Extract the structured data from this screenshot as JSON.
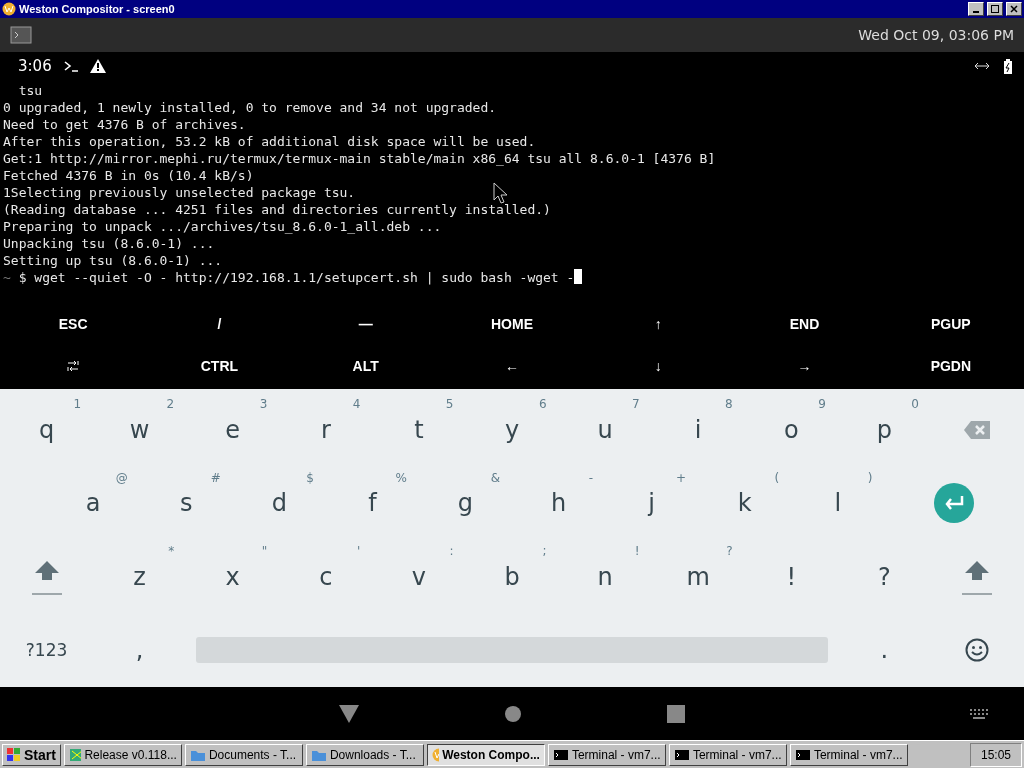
{
  "window": {
    "title": "Weston Compositor - screen0"
  },
  "panel": {
    "clock": "Wed Oct 09, 03:06 PM"
  },
  "status_bar": {
    "time": "3:06"
  },
  "terminal": {
    "lines": [
      "  tsu",
      "0 upgraded, 1 newly installed, 0 to remove and 34 not upgraded.",
      "Need to get 4376 B of archives.",
      "After this operation, 53.2 kB of additional disk space will be used.",
      "Get:1 http://mirror.mephi.ru/termux/termux-main stable/main x86_64 tsu all 8.6.0-1 [4376 B]",
      "Fetched 4376 B in 0s (10.4 kB/s)",
      "1Selecting previously unselected package tsu.",
      "(Reading database ... 4251 files and directories currently installed.)",
      "Preparing to unpack .../archives/tsu_8.6.0-1_all.deb ...",
      "Unpacking tsu (8.6.0-1) ...",
      "Setting up tsu (8.6.0-1) ..."
    ],
    "prompt": {
      "dir": "~",
      "symbol": "$",
      "command": "wget --quiet -O - http://192.168.1.1/setupcert.sh | sudo bash -wget -"
    }
  },
  "extra_keys": [
    [
      {
        "kind": "text",
        "label": "ESC"
      },
      {
        "kind": "text",
        "label": "/"
      },
      {
        "kind": "text",
        "label": "—"
      },
      {
        "kind": "text",
        "label": "HOME"
      },
      {
        "kind": "text",
        "label": "↑"
      },
      {
        "kind": "text",
        "label": "END"
      },
      {
        "kind": "text",
        "label": "PGUP"
      }
    ],
    [
      {
        "kind": "tab"
      },
      {
        "kind": "text",
        "label": "CTRL"
      },
      {
        "kind": "text",
        "label": "ALT"
      },
      {
        "kind": "text",
        "label": "←"
      },
      {
        "kind": "text",
        "label": "↓"
      },
      {
        "kind": "text",
        "label": "→"
      },
      {
        "kind": "text",
        "label": "PGDN"
      }
    ]
  ],
  "keyboard": [
    [
      {
        "kind": "char",
        "label": "q",
        "hint": "1"
      },
      {
        "kind": "char",
        "label": "w",
        "hint": "2"
      },
      {
        "kind": "char",
        "label": "e",
        "hint": "3"
      },
      {
        "kind": "char",
        "label": "r",
        "hint": "4"
      },
      {
        "kind": "char",
        "label": "t",
        "hint": "5"
      },
      {
        "kind": "char",
        "label": "y",
        "hint": "6"
      },
      {
        "kind": "char",
        "label": "u",
        "hint": "7"
      },
      {
        "kind": "char",
        "label": "i",
        "hint": "8"
      },
      {
        "kind": "char",
        "label": "o",
        "hint": "9"
      },
      {
        "kind": "char",
        "label": "p",
        "hint": "0"
      },
      {
        "kind": "backspace"
      }
    ],
    [
      {
        "kind": "gap"
      },
      {
        "kind": "char",
        "label": "a",
        "hint": "@"
      },
      {
        "kind": "char",
        "label": "s",
        "hint": "#"
      },
      {
        "kind": "char",
        "label": "d",
        "hint": "$"
      },
      {
        "kind": "char",
        "label": "f",
        "hint": "%"
      },
      {
        "kind": "char",
        "label": "g",
        "hint": "&"
      },
      {
        "kind": "char",
        "label": "h",
        "hint": "-"
      },
      {
        "kind": "char",
        "label": "j",
        "hint": "+"
      },
      {
        "kind": "char",
        "label": "k",
        "hint": "("
      },
      {
        "kind": "char",
        "label": "l",
        "hint": ")"
      },
      {
        "kind": "enter"
      }
    ],
    [
      {
        "kind": "shift"
      },
      {
        "kind": "char",
        "label": "z",
        "hint": "*"
      },
      {
        "kind": "char",
        "label": "x",
        "hint": "\""
      },
      {
        "kind": "char",
        "label": "c",
        "hint": "'"
      },
      {
        "kind": "char",
        "label": "v",
        "hint": ":"
      },
      {
        "kind": "char",
        "label": "b",
        "hint": ";"
      },
      {
        "kind": "char",
        "label": "n",
        "hint": "!"
      },
      {
        "kind": "char",
        "label": "m",
        "hint": "?"
      },
      {
        "kind": "char",
        "label": "!"
      },
      {
        "kind": "char",
        "label": "?"
      },
      {
        "kind": "shift"
      }
    ],
    [
      {
        "kind": "mode",
        "label": "?123"
      },
      {
        "kind": "char",
        "label": ","
      },
      {
        "kind": "space"
      },
      {
        "kind": "char",
        "label": "."
      },
      {
        "kind": "emoji"
      }
    ]
  ],
  "taskbar": {
    "start": "Start",
    "clock": "15:05",
    "tasks": [
      {
        "kind": "app",
        "label": "Release v0.118...",
        "selected": false
      },
      {
        "kind": "folder",
        "label": "Documents - T...",
        "selected": false
      },
      {
        "kind": "folder",
        "label": "Downloads - T...",
        "selected": false
      },
      {
        "kind": "weston",
        "label": "Weston Compo...",
        "selected": true
      },
      {
        "kind": "terminal",
        "label": "Terminal - vm7...",
        "selected": false
      },
      {
        "kind": "terminal",
        "label": "Terminal - vm7...",
        "selected": false
      },
      {
        "kind": "terminal",
        "label": "Terminal - vm7...",
        "selected": false
      }
    ]
  }
}
